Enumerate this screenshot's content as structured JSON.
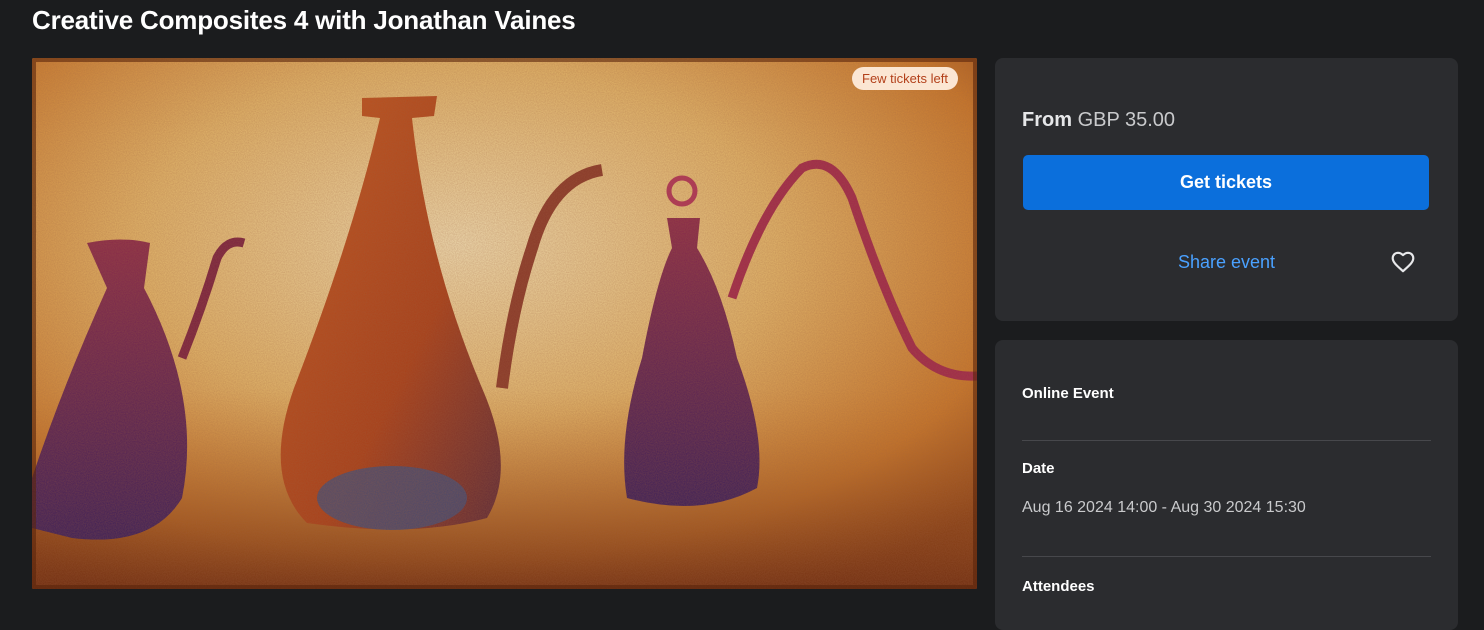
{
  "page": {
    "title": "Creative Composites 4 with Jonathan Vaines"
  },
  "hero": {
    "badge": "Few tickets left"
  },
  "ticket_card": {
    "price_prefix": "From",
    "price_value": "GBP 35.00",
    "get_tickets_label": "Get tickets",
    "share_label": "Share event"
  },
  "info_card": {
    "online_event_label": "Online Event",
    "date_label": "Date",
    "date_value": "Aug 16 2024 14:00 - Aug 30 2024 15:30",
    "attendees_label": "Attendees"
  },
  "colors": {
    "background": "#1b1c1e",
    "card": "#2b2c2f",
    "primary_button": "#0b6fdc",
    "link": "#4aa1ff",
    "badge_bg": "#fbe6d3",
    "badge_text": "#b3401a"
  },
  "icons": {
    "favorite": "heart-outline-icon"
  }
}
